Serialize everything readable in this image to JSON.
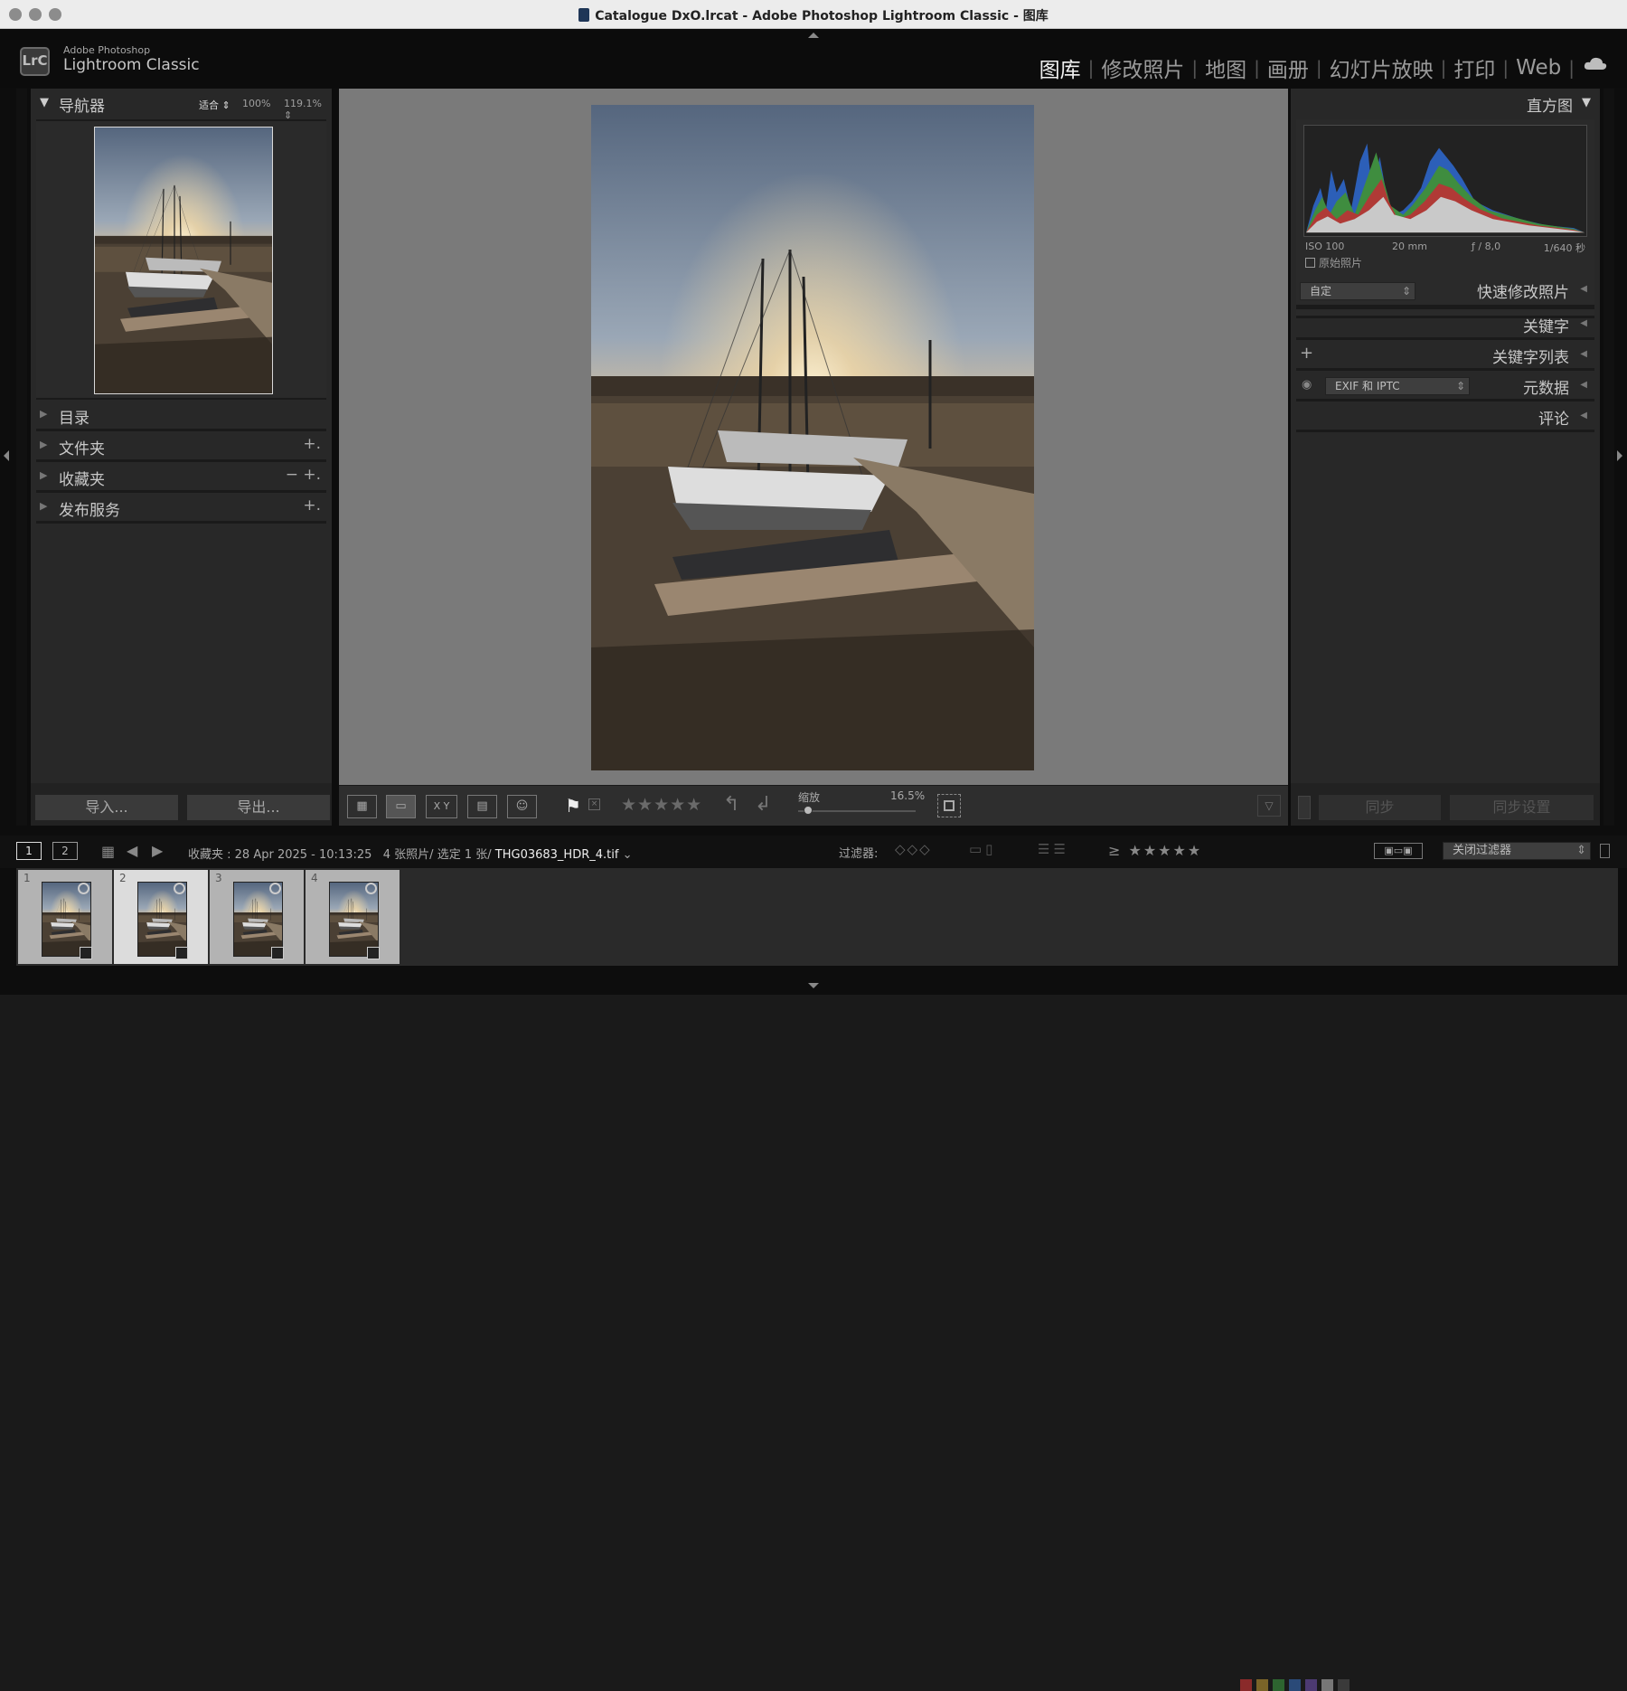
{
  "window": {
    "title": "Catalogue DxO.lrcat - Adobe Photoshop Lightroom Classic - 图库"
  },
  "brand": {
    "line1": "Adobe Photoshop",
    "line2": "Lightroom Classic",
    "logo": "LrC"
  },
  "modules": [
    "图库",
    "修改照片",
    "地图",
    "画册",
    "幻灯片放映",
    "打印",
    "Web"
  ],
  "active_module": "图库",
  "left": {
    "navigator": {
      "title": "导航器",
      "zoom_fit": "适合",
      "zoom_100": "100%",
      "zoom_custom": "119.1%"
    },
    "sections": [
      {
        "label": "目录",
        "actions": ""
      },
      {
        "label": "文件夹",
        "actions": "+."
      },
      {
        "label": "收藏夹",
        "actions": "− +."
      },
      {
        "label": "发布服务",
        "actions": "+."
      }
    ],
    "import_label": "导入...",
    "export_label": "导出..."
  },
  "right": {
    "histogram": {
      "title": "直方图",
      "iso": "ISO 100",
      "focal": "20 mm",
      "aperture": "ƒ / 8,0",
      "shutter": "1/640 秒",
      "original_label": "原始照片"
    },
    "quick_develop": {
      "preset": "自定",
      "label": "快速修改照片"
    },
    "keywording": "关键字",
    "keyword_list": "关键字列表",
    "metadata": {
      "preset": "EXIF 和 IPTC",
      "label": "元数据"
    },
    "comments": "评论",
    "sync_label": "同步",
    "sync_settings_label": "同步设置"
  },
  "toolbar": {
    "zoom_label": "缩放",
    "zoom_value": "16.5%",
    "stars": "★★★★★",
    "compare_label": "X Y"
  },
  "filmbar": {
    "view1": "1",
    "view2": "2",
    "source": "收藏夹 : 28 Apr 2025 - 10:13:25",
    "count": "4 张照片/",
    "selected": "选定 1 张/",
    "filename": "THG03683_HDR_4.tif",
    "filter_label": "过滤器:",
    "filter_stars": "≥ ★★★★★",
    "filter_preset": "关闭过滤器"
  },
  "filmstrip": [
    {
      "num": "1"
    },
    {
      "num": "2"
    },
    {
      "num": "3"
    },
    {
      "num": "4"
    }
  ],
  "colors": {
    "accent": "#f0f0f0",
    "label_red": "#8a2a2a",
    "label_yellow": "#7a6428",
    "label_green": "#2d6430",
    "label_blue": "#2a4a78",
    "label_purple": "#4c3a72"
  }
}
